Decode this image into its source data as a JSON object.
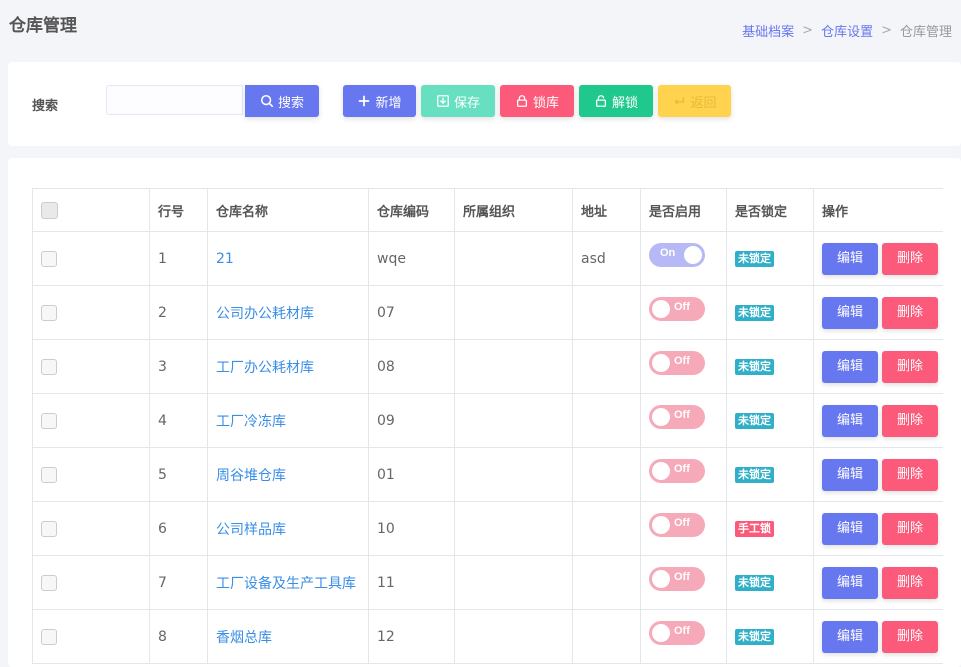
{
  "header": {
    "title": "仓库管理",
    "breadcrumb": [
      "基础档案",
      "仓库设置",
      "仓库管理"
    ],
    "separator": ">"
  },
  "toolbar": {
    "search_label": "搜索",
    "search_value": "",
    "search_button": "搜索",
    "add_button": "新增",
    "save_button": "保存",
    "lock_button": "锁库",
    "unlock_button": "解锁",
    "back_button": "返回"
  },
  "table": {
    "columns": [
      "行号",
      "仓库名称",
      "仓库编码",
      "所属组织",
      "地址",
      "是否启用",
      "是否锁定",
      "操作"
    ],
    "rows": [
      {
        "no": "1",
        "name": "21",
        "code": "wqe",
        "org": "",
        "address": "asd",
        "enabled": "On",
        "lock": "未锁定"
      },
      {
        "no": "2",
        "name": "公司办公耗材库",
        "code": "07",
        "org": "",
        "address": "",
        "enabled": "Off",
        "lock": "未锁定"
      },
      {
        "no": "3",
        "name": "工厂办公耗材库",
        "code": "08",
        "org": "",
        "address": "",
        "enabled": "Off",
        "lock": "未锁定"
      },
      {
        "no": "4",
        "name": "工厂冷冻库",
        "code": "09",
        "org": "",
        "address": "",
        "enabled": "Off",
        "lock": "未锁定"
      },
      {
        "no": "5",
        "name": "周谷堆仓库",
        "code": "01",
        "org": "",
        "address": "",
        "enabled": "Off",
        "lock": "未锁定"
      },
      {
        "no": "6",
        "name": "公司样品库",
        "code": "10",
        "org": "",
        "address": "",
        "enabled": "Off",
        "lock": "手工锁"
      },
      {
        "no": "7",
        "name": "工厂设备及生产工具库",
        "code": "11",
        "org": "",
        "address": "",
        "enabled": "Off",
        "lock": "未锁定"
      },
      {
        "no": "8",
        "name": "香烟总库",
        "code": "12",
        "org": "",
        "address": "",
        "enabled": "Off",
        "lock": "未锁定"
      }
    ],
    "edit_label": "编辑",
    "delete_label": "删除"
  },
  "colors": {
    "primary": "#6777ef",
    "danger": "#fc5a7a",
    "success": "#1fc98e",
    "info": "#66e0c0",
    "warning": "#ffd34e",
    "link": "#3a8ee6"
  }
}
